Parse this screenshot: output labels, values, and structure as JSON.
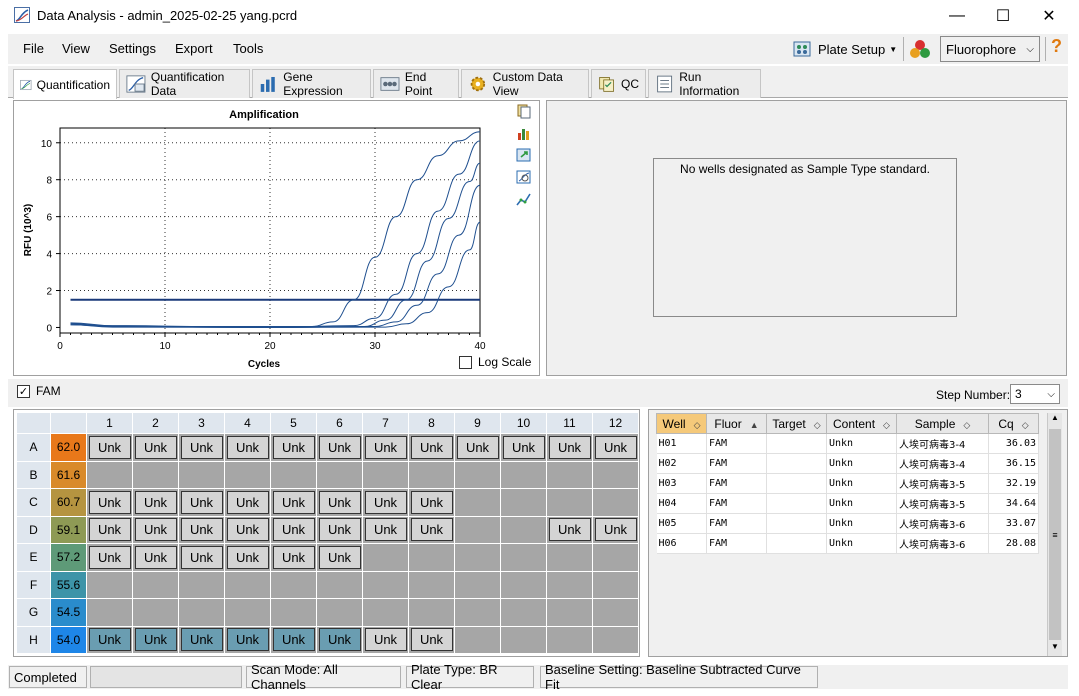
{
  "window": {
    "title": "Data Analysis - admin_2025-02-25 yang.pcrd",
    "minimize": "—",
    "maximize": "☐",
    "close": "✕"
  },
  "menu": [
    "File",
    "View",
    "Settings",
    "Export",
    "Tools"
  ],
  "toolbar": {
    "plate_setup": "Plate Setup",
    "fluorophore": "Fluorophore",
    "help": "?"
  },
  "tabs": [
    "Quantification",
    "Quantification Data",
    "Gene Expression",
    "End Point",
    "Custom Data View",
    "QC",
    "Run Information"
  ],
  "chart_data": {
    "type": "line",
    "title": "Amplification",
    "xlabel": "Cycles",
    "ylabel": "RFU (10^3)",
    "xlim": [
      0,
      40
    ],
    "ylim": [
      -0.3,
      10.8
    ],
    "xticks": [
      "0",
      "10",
      "20",
      "30",
      "40"
    ],
    "yticks": [
      "0",
      "2",
      "4",
      "6",
      "8",
      "10"
    ],
    "threshold": 1.5,
    "grid": true,
    "series": [
      {
        "values": [
          [
            1,
            0.25
          ],
          [
            5,
            0.1
          ],
          [
            15,
            0.05
          ],
          [
            24,
            0.05
          ],
          [
            26,
            0.3
          ],
          [
            28,
            1.5
          ],
          [
            30,
            3.8
          ],
          [
            32,
            6.0
          ],
          [
            34,
            8.0
          ],
          [
            36,
            9.3
          ],
          [
            38,
            10.1
          ],
          [
            40,
            10.6
          ]
        ]
      },
      {
        "values": [
          [
            1,
            0.2
          ],
          [
            5,
            0.05
          ],
          [
            20,
            0.0
          ],
          [
            28,
            0.1
          ],
          [
            30,
            0.5
          ],
          [
            32,
            1.8
          ],
          [
            34,
            4.0
          ],
          [
            36,
            6.3
          ],
          [
            38,
            8.3
          ],
          [
            40,
            10.1
          ]
        ]
      },
      {
        "values": [
          [
            1,
            0.2
          ],
          [
            5,
            0.05
          ],
          [
            20,
            0.0
          ],
          [
            29,
            0.05
          ],
          [
            31,
            0.4
          ],
          [
            33,
            1.5
          ],
          [
            35,
            3.6
          ],
          [
            37,
            5.9
          ],
          [
            39,
            7.9
          ],
          [
            40,
            8.9
          ]
        ]
      },
      {
        "values": [
          [
            1,
            0.15
          ],
          [
            5,
            0.05
          ],
          [
            20,
            0.0
          ],
          [
            30,
            0.05
          ],
          [
            32,
            0.3
          ],
          [
            34,
            1.2
          ],
          [
            36,
            2.9
          ],
          [
            38,
            5.0
          ],
          [
            40,
            7.7
          ]
        ]
      },
      {
        "values": [
          [
            1,
            0.15
          ],
          [
            5,
            0.02
          ],
          [
            20,
            0.0
          ],
          [
            31,
            0.02
          ],
          [
            33,
            0.2
          ],
          [
            35,
            0.8
          ],
          [
            37,
            2.2
          ],
          [
            39,
            4.2
          ],
          [
            40,
            5.7
          ]
        ]
      }
    ]
  },
  "chart_options": {
    "log_scale": "Log Scale"
  },
  "std_message": "No wells designated as Sample Type standard.",
  "fam_label": "FAM",
  "step": {
    "label": "Step Number:",
    "value": "3"
  },
  "plate": {
    "cols": [
      "1",
      "2",
      "3",
      "4",
      "5",
      "6",
      "7",
      "8",
      "9",
      "10",
      "11",
      "12"
    ],
    "rows": [
      {
        "label": "A",
        "temp": "62.0",
        "color": "#e8781a",
        "wells": [
          "Unk",
          "Unk",
          "Unk",
          "Unk",
          "Unk",
          "Unk",
          "Unk",
          "Unk",
          "Unk",
          "Unk",
          "Unk",
          "Unk"
        ],
        "blue": []
      },
      {
        "label": "B",
        "temp": "61.6",
        "color": "#d98a2a",
        "wells": [
          "",
          "",
          "",
          "",
          "",
          "",
          "",
          "",
          "",
          "",
          "",
          ""
        ],
        "blue": []
      },
      {
        "label": "C",
        "temp": "60.7",
        "color": "#b59440",
        "wells": [
          "Unk",
          "Unk",
          "Unk",
          "Unk",
          "Unk",
          "Unk",
          "Unk",
          "Unk",
          "",
          "",
          "",
          ""
        ],
        "blue": []
      },
      {
        "label": "D",
        "temp": "59.1",
        "color": "#8e9a55",
        "wells": [
          "Unk",
          "Unk",
          "Unk",
          "Unk",
          "Unk",
          "Unk",
          "Unk",
          "Unk",
          "",
          "",
          "Unk",
          "Unk"
        ],
        "blue": []
      },
      {
        "label": "E",
        "temp": "57.2",
        "color": "#5e9a78",
        "wells": [
          "Unk",
          "Unk",
          "Unk",
          "Unk",
          "Unk",
          "Unk",
          "",
          "",
          "",
          "",
          "",
          ""
        ],
        "blue": []
      },
      {
        "label": "F",
        "temp": "55.6",
        "color": "#3d94a8",
        "wells": [
          "",
          "",
          "",
          "",
          "",
          "",
          "",
          "",
          "",
          "",
          "",
          ""
        ],
        "blue": []
      },
      {
        "label": "G",
        "temp": "54.5",
        "color": "#2a8ccc",
        "wells": [
          "",
          "",
          "",
          "",
          "",
          "",
          "",
          "",
          "",
          "",
          "",
          ""
        ],
        "blue": []
      },
      {
        "label": "H",
        "temp": "54.0",
        "color": "#1e86e8",
        "wells": [
          "Unk",
          "Unk",
          "Unk",
          "Unk",
          "Unk",
          "Unk",
          "Unk",
          "Unk",
          "",
          "",
          "",
          ""
        ],
        "blue": [
          0,
          1,
          2,
          3,
          4,
          5
        ]
      }
    ]
  },
  "wells_table": {
    "headers": [
      "Well",
      "Fluor",
      "Target",
      "Content",
      "Sample",
      "Cq"
    ],
    "rows": [
      [
        "H01",
        "FAM",
        "",
        "Unkn",
        "人埃可病毒3-4",
        "36.03"
      ],
      [
        "H02",
        "FAM",
        "",
        "Unkn",
        "人埃可病毒3-4",
        "36.15"
      ],
      [
        "H03",
        "FAM",
        "",
        "Unkn",
        "人埃可病毒3-5",
        "32.19"
      ],
      [
        "H04",
        "FAM",
        "",
        "Unkn",
        "人埃可病毒3-5",
        "34.64"
      ],
      [
        "H05",
        "FAM",
        "",
        "Unkn",
        "人埃可病毒3-6",
        "33.07"
      ],
      [
        "H06",
        "FAM",
        "",
        "Unkn",
        "人埃可病毒3-6",
        "28.08"
      ]
    ]
  },
  "status": {
    "state": "Completed",
    "scan_mode": "Scan Mode: All Channels",
    "plate_type": "Plate Type: BR Clear",
    "baseline": "Baseline Setting: Baseline Subtracted Curve Fit"
  }
}
